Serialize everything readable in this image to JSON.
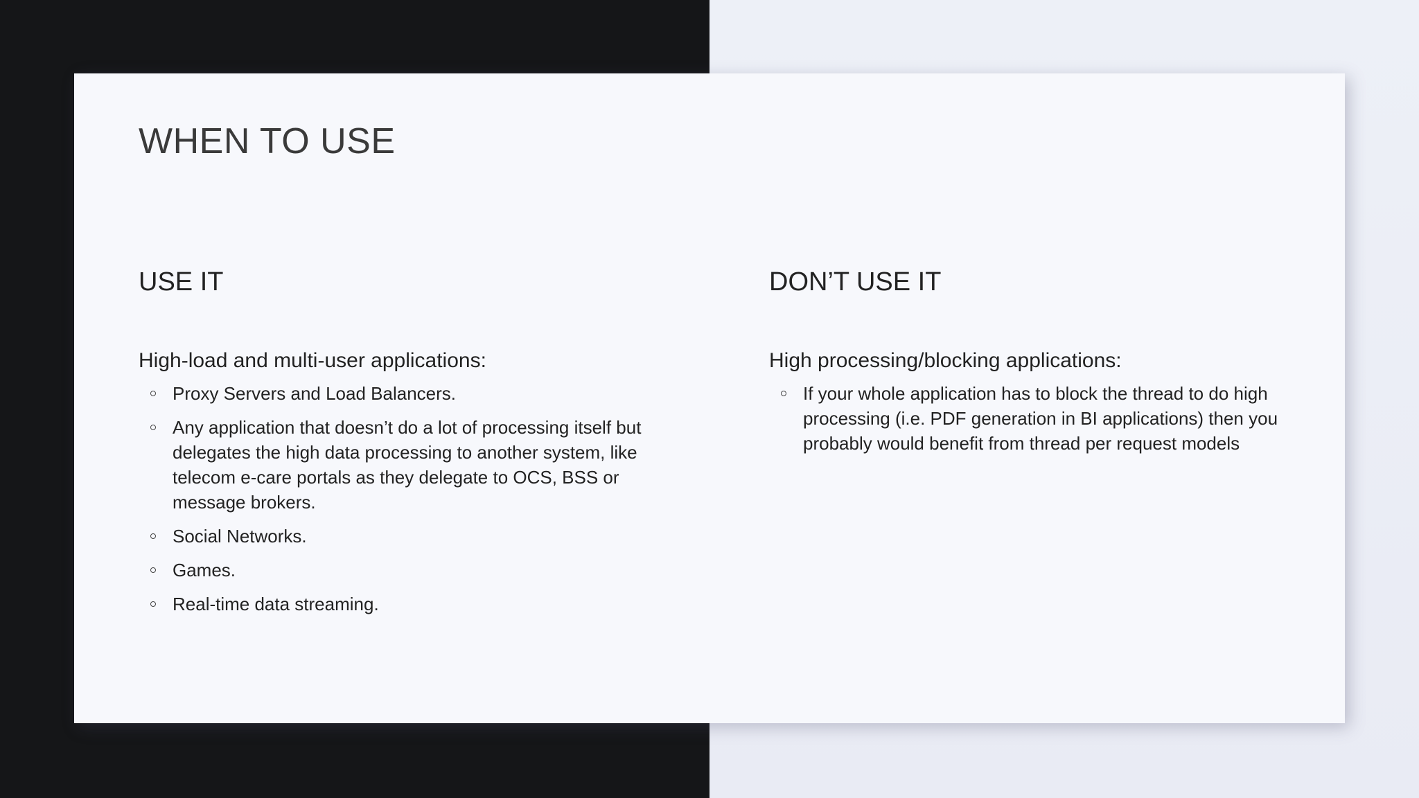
{
  "slide": {
    "title": "WHEN TO USE",
    "left": {
      "heading": "USE IT",
      "intro": "High-load and multi-user applications:",
      "bullets": [
        "Proxy Servers and Load Balancers.",
        "Any application that doesn’t do a lot of processing itself but delegates the high data processing to another system, like telecom e-care portals as they delegate to OCS, BSS or message brokers.",
        "Social Networks.",
        "Games.",
        "Real-time data streaming."
      ]
    },
    "right": {
      "heading": "DON’T USE IT",
      "intro": "High processing/blocking applications:",
      "bullets": [
        "If your whole application has to block the thread to do high processing (i.e. PDF generation in BI applications) then you probably would benefit from thread per request models"
      ]
    }
  },
  "colors": {
    "left_background": "#151618",
    "right_background": "#edf0f7",
    "slide_background": "#f7f8fc",
    "text": "#222222"
  },
  "icons": {
    "bullet": "hollow-circle-bullet-icon"
  }
}
